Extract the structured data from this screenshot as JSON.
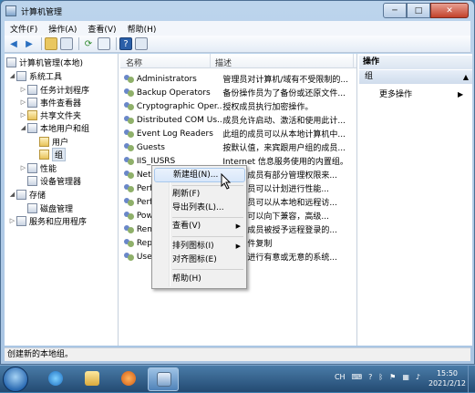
{
  "window": {
    "title": "计算机管理",
    "min_label": "─",
    "max_label": "□",
    "close_label": "✕"
  },
  "menu": [
    "文件(F)",
    "操作(A)",
    "查看(V)",
    "帮助(H)"
  ],
  "tree": {
    "items": [
      {
        "label": "计算机管理(本地)",
        "exp": ""
      },
      {
        "label": "系统工具",
        "exp": "◢"
      },
      {
        "label": "任务计划程序",
        "exp": "▷"
      },
      {
        "label": "事件查看器",
        "exp": "▷"
      },
      {
        "label": "共享文件夹",
        "exp": "▷"
      },
      {
        "label": "本地用户和组",
        "exp": "◢"
      },
      {
        "label": "用户",
        "exp": ""
      },
      {
        "label": "组",
        "exp": ""
      },
      {
        "label": "性能",
        "exp": "▷"
      },
      {
        "label": "设备管理器",
        "exp": ""
      },
      {
        "label": "存储",
        "exp": "◢"
      },
      {
        "label": "磁盘管理",
        "exp": ""
      },
      {
        "label": "服务和应用程序",
        "exp": "▷"
      }
    ]
  },
  "list": {
    "col_name": "名称",
    "col_desc": "描述",
    "rows": [
      {
        "name": "Administrators",
        "desc": "管理员对计算机/域有不受限制的..."
      },
      {
        "name": "Backup Operators",
        "desc": "备份操作员为了备份或还原文件..."
      },
      {
        "name": "Cryptographic Oper...",
        "desc": "授权成员执行加密操作。"
      },
      {
        "name": "Distributed COM Us...",
        "desc": "成员允许启动、激活和使用此计..."
      },
      {
        "name": "Event Log Readers",
        "desc": "此组的成员可以从本地计算机中..."
      },
      {
        "name": "Guests",
        "desc": "按默认值，来宾跟用户组的成员..."
      },
      {
        "name": "IIS_IUSRS",
        "desc": "Internet 信息服务使用的内置组。"
      },
      {
        "name": "Netw",
        "desc": "组中的成员有部分管理权限来..."
      },
      {
        "name": "Perfo",
        "desc": "组的成员可以计划进行性能..."
      },
      {
        "name": "Perfo",
        "desc": "组的成员可以从本地和远程访..."
      },
      {
        "name": "Powe",
        "desc": "的成员可以向下兼容，高级..."
      },
      {
        "name": "Remo",
        "desc": "组中的成员被授予远程登录的..."
      },
      {
        "name": "Repli",
        "desc": "中的文件复制"
      },
      {
        "name": "Users",
        "desc": "户无法进行有意或无意的系统..."
      }
    ]
  },
  "actions": {
    "header": "操作",
    "group": "组",
    "group_chev": "▲",
    "more": "更多操作",
    "more_chev": "▶"
  },
  "context_menu": {
    "items": [
      "新建组(N)...",
      "刷新(F)",
      "导出列表(L)...",
      "查看(V)",
      "排列图标(I)",
      "对齐图标(E)",
      "帮助(H)"
    ],
    "submenu_arrow": "▶"
  },
  "status": "创建新的本地组。",
  "taskbar": {
    "tray_lang": "CH",
    "time": "15:50",
    "date": "2021/2/12"
  }
}
